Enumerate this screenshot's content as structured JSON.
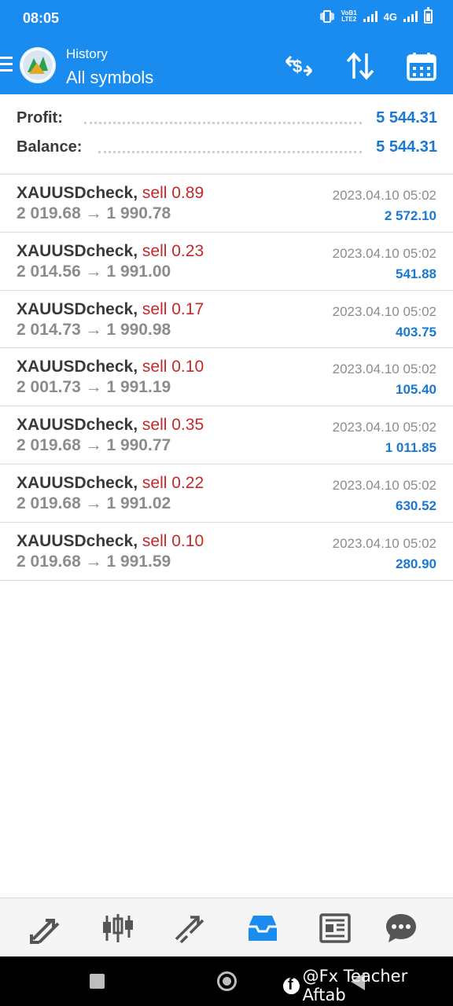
{
  "status_bar": {
    "time": "08:05",
    "volte_top": "VoB1",
    "volte_bottom": "LTE2",
    "network": "4G"
  },
  "header": {
    "label": "History",
    "title": "All symbols"
  },
  "summary": [
    {
      "label": "Profit:",
      "value": "5 544.31"
    },
    {
      "label": "Balance:",
      "value": "5 544.31"
    }
  ],
  "deals": [
    {
      "symbol": "XAUUSDcheck,",
      "side": "sell 0.89",
      "open": "2 019.68",
      "close": "1 990.78",
      "time": "2023.04.10 05:02",
      "profit": "2 572.10"
    },
    {
      "symbol": "XAUUSDcheck,",
      "side": "sell 0.23",
      "open": "2 014.56",
      "close": "1 991.00",
      "time": "2023.04.10 05:02",
      "profit": "541.88"
    },
    {
      "symbol": "XAUUSDcheck,",
      "side": "sell 0.17",
      "open": "2 014.73",
      "close": "1 990.98",
      "time": "2023.04.10 05:02",
      "profit": "403.75"
    },
    {
      "symbol": "XAUUSDcheck,",
      "side": "sell 0.10",
      "open": "2 001.73",
      "close": "1 991.19",
      "time": "2023.04.10 05:02",
      "profit": "105.40"
    },
    {
      "symbol": "XAUUSDcheck,",
      "side": "sell 0.35",
      "open": "2 019.68",
      "close": "1 990.77",
      "time": "2023.04.10 05:02",
      "profit": "1 011.85"
    },
    {
      "symbol": "XAUUSDcheck,",
      "side": "sell 0.22",
      "open": "2 019.68",
      "close": "1 991.02",
      "time": "2023.04.10 05:02",
      "profit": "630.52"
    },
    {
      "symbol": "XAUUSDcheck,",
      "side": "sell 0.10",
      "open": "2 019.68",
      "close": "1 991.59",
      "time": "2023.04.10 05:02",
      "profit": "280.90"
    }
  ],
  "arrow": "→",
  "tabs": [
    {
      "icon": "quotes-icon"
    },
    {
      "icon": "chart-candles-icon"
    },
    {
      "icon": "trade-icon"
    },
    {
      "icon": "history-inbox-icon",
      "active": true
    },
    {
      "icon": "news-icon"
    },
    {
      "icon": "chat-icon"
    }
  ],
  "colors": {
    "brand": "#1a8cf0",
    "profit": "#1a78d2",
    "sell": "#c62828",
    "active_tab": "#1a8cf0",
    "inactive_tab": "#555555"
  },
  "watermark": "@Fx Teacher Aftab"
}
